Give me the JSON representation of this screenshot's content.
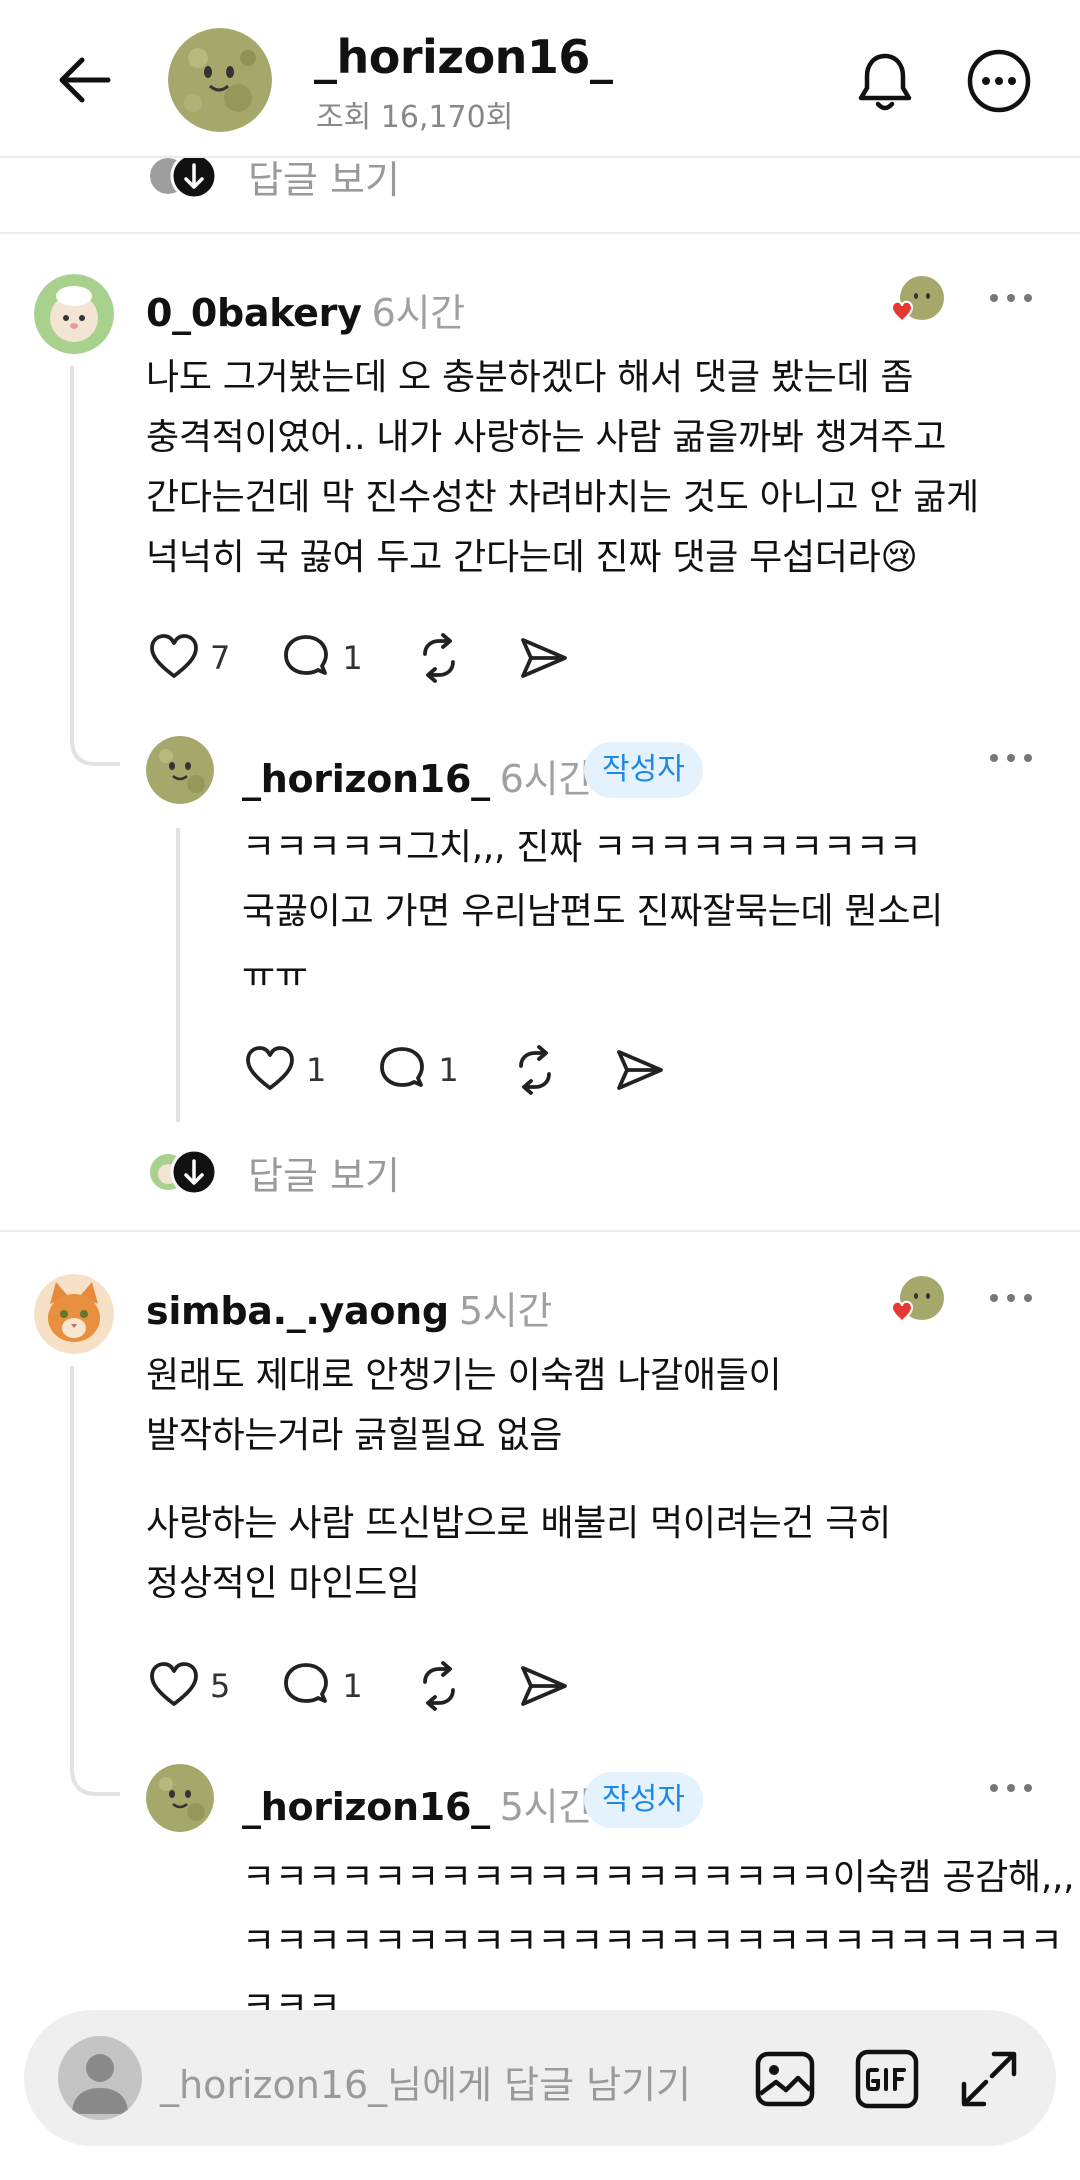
{
  "header": {
    "title": "_horizon16_",
    "views": "조회 16,170회"
  },
  "top_replies": {
    "label": "답글 보기"
  },
  "comments": [
    {
      "username": "0_0bakery",
      "time": "6시간",
      "text_lines": [
        "나도 그거봤는데 오 충분하겠다 해서 댓글 봤는데 좀",
        "충격적이였어.. 내가 사랑하는 사람 굶을까봐 챙겨주고",
        "간다는건데 막 진수성찬 차려바치는 것도 아니고 안 굶게",
        "넉넉히 국 끓여 두고 간다는데 진짜 댓글 무섭더라😢"
      ],
      "likes": "7",
      "replies": "1",
      "reply": {
        "username": "_horizon16_",
        "time": "6시간",
        "badge": "작성자",
        "text_lines": [
          "ㅋㅋㅋㅋㅋ그치,,, 진짜 ㅋㅋㅋㅋㅋㅋㅋㅋㅋㅋ",
          "국끓이고 가면 우리남편도 진짜잘묵는데 뭔소리",
          "ㅠㅠ"
        ],
        "likes": "1",
        "replies": "1"
      },
      "view_replies": "답글 보기"
    },
    {
      "username": "simba._.yaong",
      "time": "5시간",
      "text_lines": [
        "원래도 제대로 안챙기는 이숙캠 나갈애들이",
        "발작하는거라 긁힐필요 없음"
      ],
      "text_lines_2": [
        "사랑하는 사람 뜨신밥으로 배불리 먹이려는건 극히",
        "정상적인 마인드임"
      ],
      "likes": "5",
      "replies": "1",
      "reply": {
        "username": "_horizon16_",
        "time": "5시간",
        "badge": "작성자",
        "text_lines": [
          "ㅋㅋㅋㅋㅋㅋㅋㅋㅋㅋㅋㅋㅋㅋㅋㅋㅋㅋ이숙캠 공감해,,,",
          "ㅋㅋㅋㅋㅋㅋㅋㅋㅋㅋㅋㅋㅋㅋㅋㅋㅋㅋㅋㅋㅋㅋㅋㅋㅋ",
          "ㅋㅋㅋ"
        ]
      }
    }
  ],
  "input": {
    "placeholder": "_horizon16_님에게 답글 남기기"
  },
  "icons": {
    "back": "arrow-left-icon",
    "bell": "bell-icon",
    "more": "more-icon",
    "heart": "heart-icon",
    "reply": "comment-icon",
    "repost": "repost-icon",
    "share": "send-icon",
    "image": "image-icon",
    "gif": "gif-icon",
    "expand": "expand-icon"
  },
  "colors": {
    "badge_bg": "#e3f2fd",
    "badge_text": "#1e88e5",
    "liked_heart": "#e53935",
    "muted": "#9a9a9a"
  }
}
